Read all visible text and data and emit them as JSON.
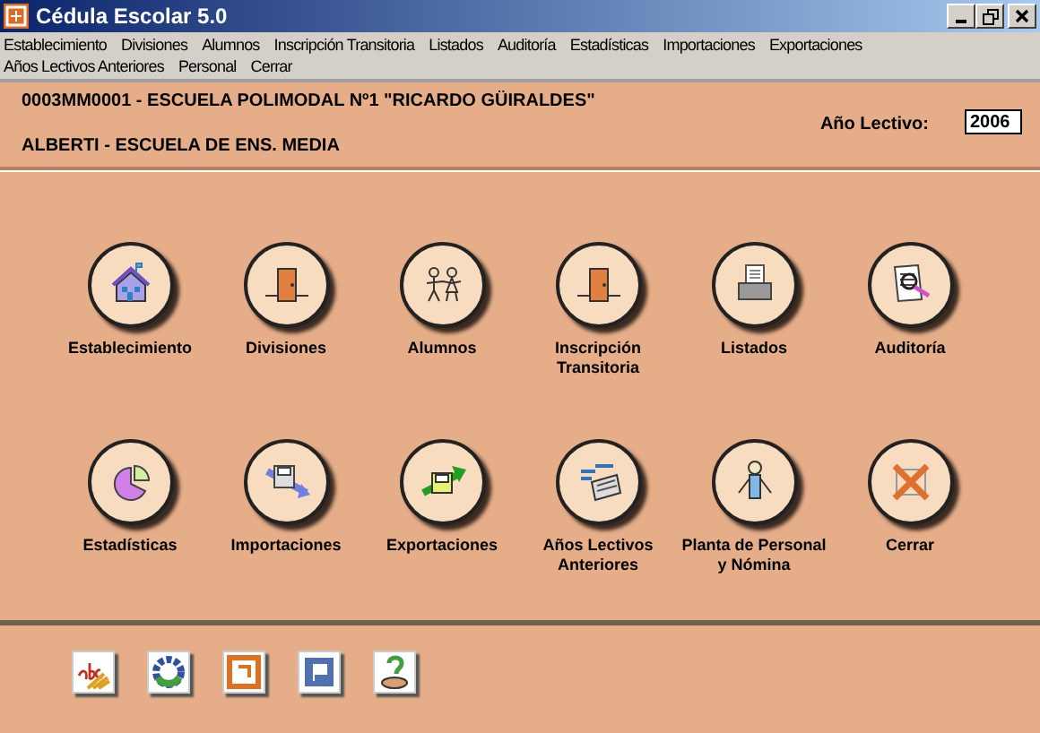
{
  "window": {
    "title": "Cédula Escolar 5.0"
  },
  "menu": [
    "Establecimiento",
    "Divisiones",
    "Alumnos",
    "Inscripción Transitoria",
    "Listados",
    "Auditoría",
    "Estadísticas",
    "Importaciones",
    "Exportaciones",
    "Años Lectivos Anteriores",
    "Personal",
    "Cerrar"
  ],
  "header": {
    "school": "0003MM0001 - ESCUELA POLIMODAL Nº1 \"RICARDO GÜIRALDES\"",
    "district": "ALBERTI - ESCUELA DE ENS. MEDIA",
    "year_label": "Año Lectivo:",
    "year_value": "2006"
  },
  "modules": [
    {
      "kind": "house",
      "label": "Establecimiento"
    },
    {
      "kind": "door",
      "label": "Divisiones"
    },
    {
      "kind": "children",
      "label": "Alumnos"
    },
    {
      "kind": "door",
      "label": "Inscripción Transitoria"
    },
    {
      "kind": "printer",
      "label": "Listados"
    },
    {
      "kind": "audit",
      "label": "Auditoría"
    },
    {
      "kind": "pie",
      "label": "Estadísticas"
    },
    {
      "kind": "import",
      "label": "Importaciones"
    },
    {
      "kind": "export",
      "label": "Exportaciones"
    },
    {
      "kind": "archive",
      "label": "Años Lectivos Anteriores"
    },
    {
      "kind": "person",
      "label": "Planta de Personal y Nómina"
    },
    {
      "kind": "close",
      "label": "Cerrar"
    }
  ],
  "toolbar": [
    {
      "kind": "letters"
    },
    {
      "kind": "ring"
    },
    {
      "kind": "frame"
    },
    {
      "kind": "flag"
    },
    {
      "kind": "help"
    }
  ]
}
